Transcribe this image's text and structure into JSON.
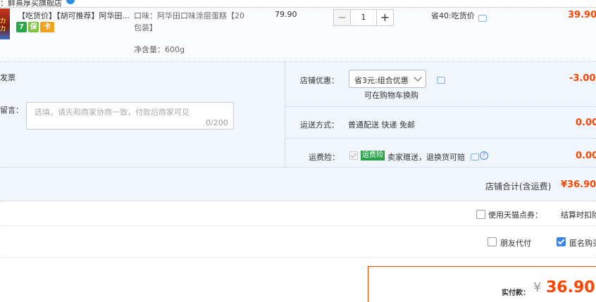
{
  "shop": {
    "name": "：鲜熹厚买旗舰店"
  },
  "item": {
    "thumb_text": "力力",
    "title": "【吃货价】【胡可推荐】阿华田...",
    "tags": [
      "7",
      "保",
      "卡"
    ],
    "sku_label": "口味：阿华田口味涂层蛋糕【20包装】",
    "net_weight": "净含量：600g",
    "unit_price": "79.90",
    "quantity": "1",
    "minus": "−",
    "plus": "+",
    "saving": "省40:吃货价",
    "subtotal": "39.90"
  },
  "options": {
    "invoice_label": "开具发票",
    "message_label": "买家留言：",
    "message_placeholder": "选填，请先和商家协商一致，付款后商家可见",
    "message_count": "0/200",
    "discount_label": "店铺优惠：",
    "discount_selected": "省3元:组合优惠",
    "discount_value": "-3.00",
    "discount_note": "可在购物车换购",
    "shipping_label": "运送方式：",
    "shipping_value": "普通配送 快递 免邮",
    "shipping_fee": "0.00",
    "insurance_label": "运费险：",
    "insurance_badge": "运费险",
    "insurance_text": "卖家赠送，退换货可赔",
    "insurance_help": "?",
    "insurance_fee": "0.00"
  },
  "shop_total": {
    "label": "店铺合计(含运费)",
    "value": "¥36.90"
  },
  "coupon": {
    "label": "使用天猫点券：",
    "note": "结算时扣除"
  },
  "extras": {
    "friend_pay": "朋友代付",
    "anonymous": "匿名购买"
  },
  "payment": {
    "label": "实付款：",
    "currency": "¥",
    "amount": "36.90"
  }
}
